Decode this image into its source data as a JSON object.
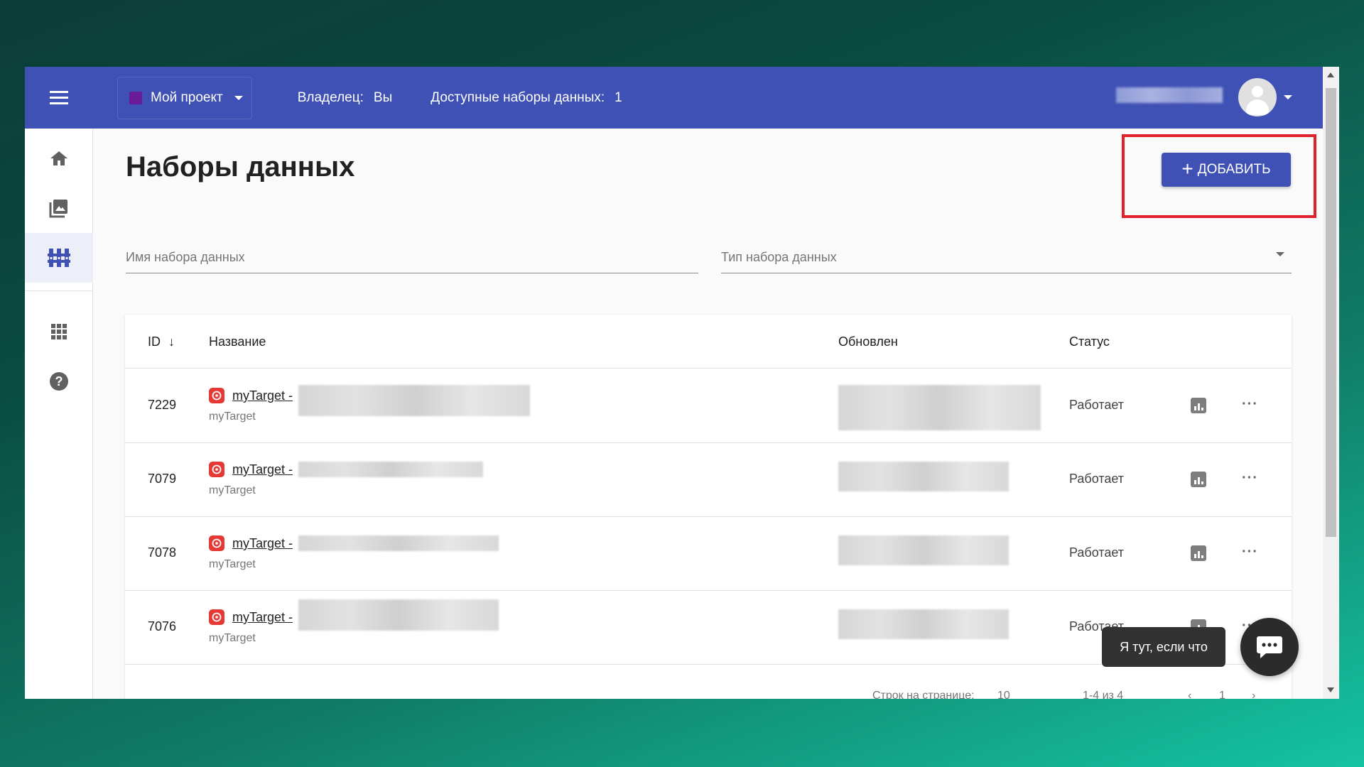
{
  "topbar": {
    "project_label": "Мой проект",
    "owner_label": "Владелец:",
    "owner_value": "Вы",
    "datasets_label": "Доступные наборы данных:",
    "datasets_value": "1"
  },
  "sidebar": {
    "items": [
      {
        "icon": "home-icon"
      },
      {
        "icon": "images-icon"
      },
      {
        "icon": "datasets-icon",
        "active": true
      },
      {
        "icon": "apps-grid-icon"
      },
      {
        "icon": "help-icon"
      }
    ]
  },
  "page": {
    "title": "Наборы данных",
    "add_button": "ДОБАВИТЬ"
  },
  "filters": {
    "name_placeholder": "Имя набора данных",
    "type_placeholder": "Тип набора данных"
  },
  "table": {
    "columns": {
      "id": "ID",
      "name": "Название",
      "updated": "Обновлен",
      "status": "Статус"
    },
    "rows": [
      {
        "id": "7229",
        "name": "myTarget -",
        "source": "myTarget",
        "status": "Работает"
      },
      {
        "id": "7079",
        "name": "myTarget -",
        "source": "myTarget",
        "status": "Работает"
      },
      {
        "id": "7078",
        "name": "myTarget -",
        "source": "myTarget",
        "status": "Работает"
      },
      {
        "id": "7076",
        "name": "myTarget -",
        "source": "myTarget",
        "status": "Работает"
      }
    ],
    "pagination": {
      "rows_per_page_label": "Строк на странице:",
      "rows_per_page": "10",
      "range": "1-4 из 4",
      "page": "1"
    }
  },
  "chat": {
    "tooltip": "Я тут, если что"
  },
  "colors": {
    "primary": "#3f51b5",
    "highlight": "#e0202a",
    "source_icon": "#e53935"
  }
}
